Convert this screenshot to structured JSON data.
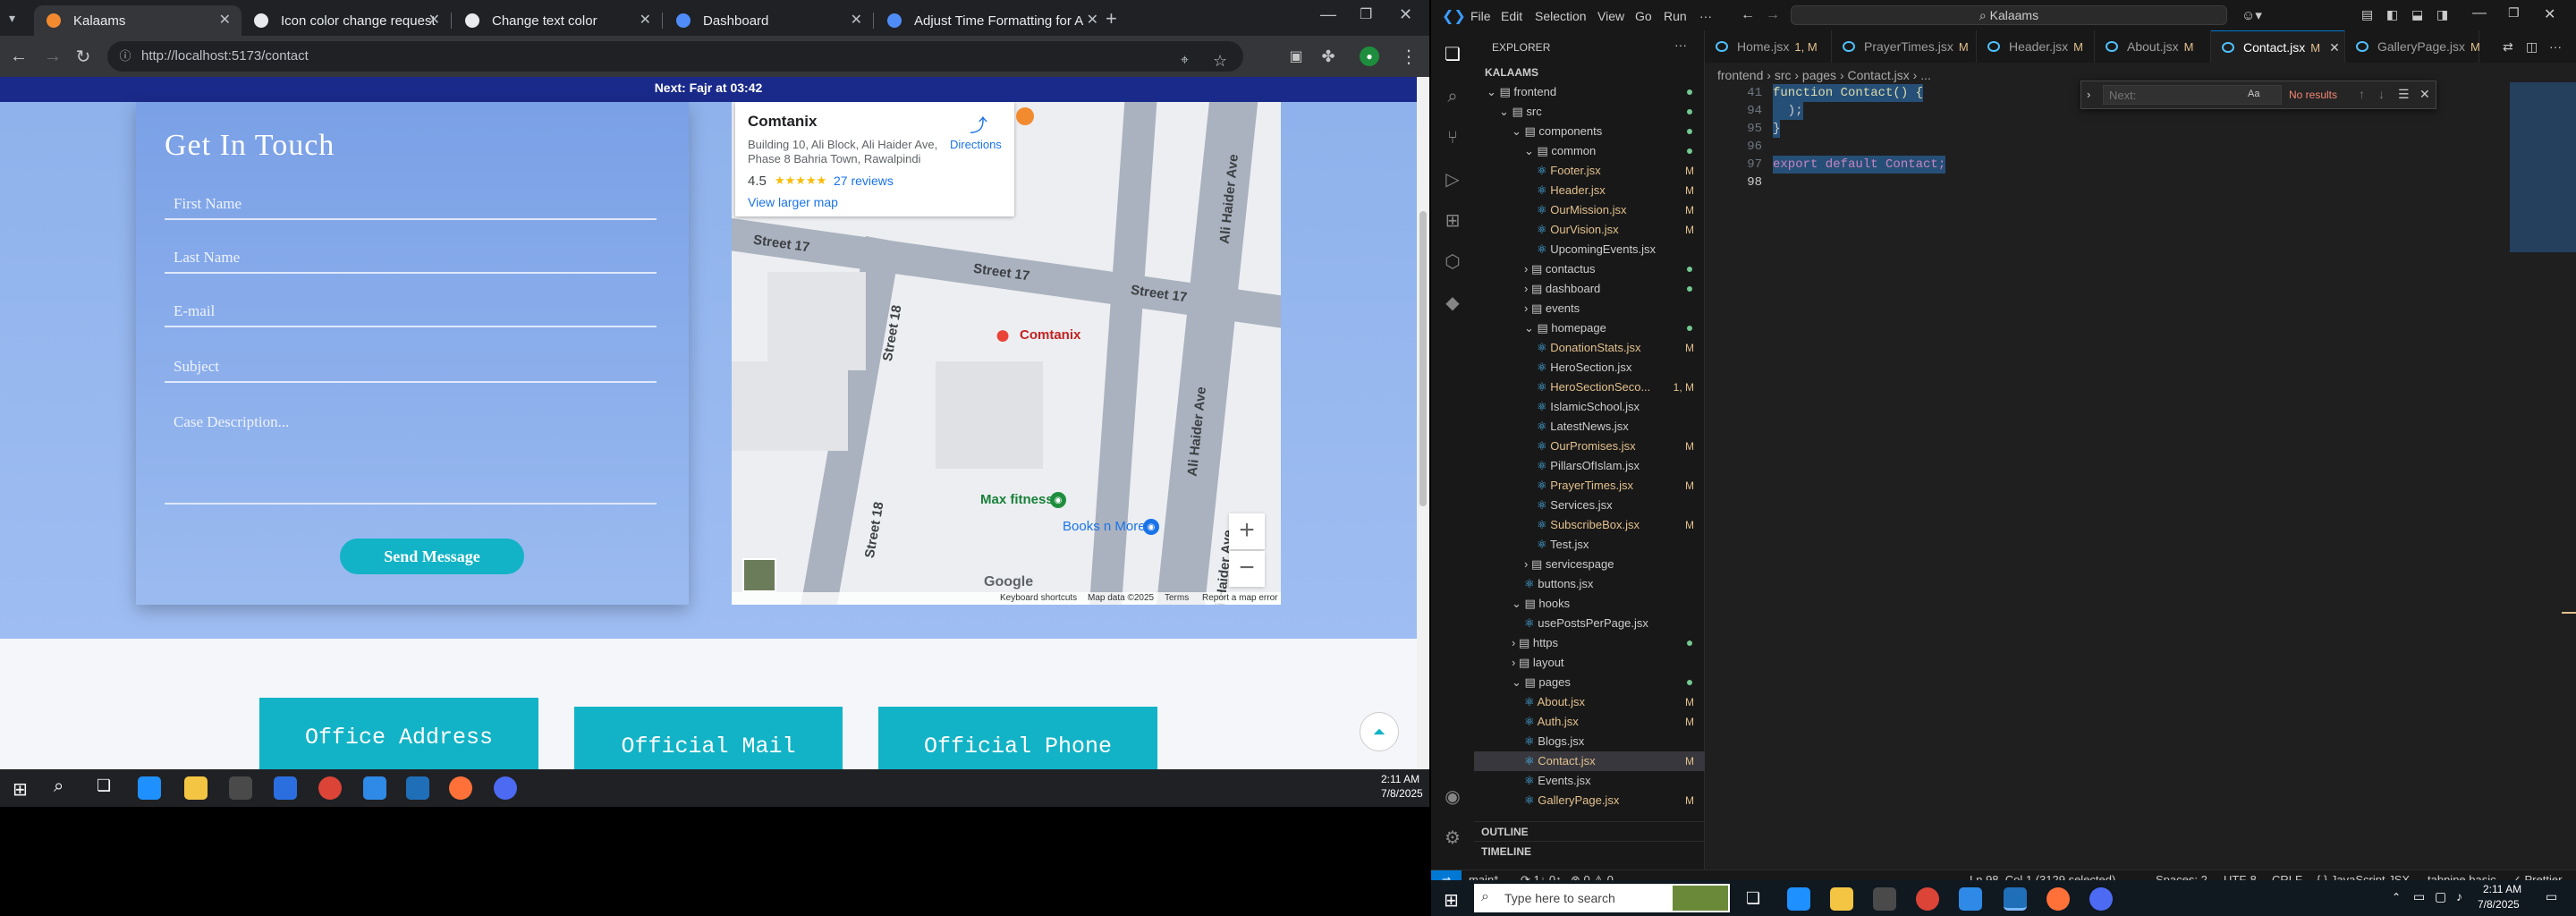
{
  "browser": {
    "tabs": [
      {
        "label": "Kalaams",
        "active": true
      },
      {
        "label": "Icon color change request"
      },
      {
        "label": "Change text color"
      },
      {
        "label": "Dashboard"
      },
      {
        "label": "Adjust Time Formatting for AM"
      }
    ],
    "url": "http://localhost:5173/contact"
  },
  "site": {
    "prayer_bar": "Next: Fajr at 03:42",
    "form": {
      "title": "Get In Touch",
      "first_name": "First Name",
      "last_name": "Last Name",
      "email": "E-mail",
      "subject": "Subject",
      "description": "Case Description...",
      "send": "Send Message"
    },
    "map": {
      "place_name": "Comtanix",
      "address_line1": "Building 10, Ali Block, Ali Haider Ave,",
      "address_line2": "Phase 8 Bahria Town, Rawalpindi",
      "directions": "Directions",
      "rating": "4.5",
      "stars": "★★★★★",
      "reviews": "27 reviews",
      "larger_map": "View larger map",
      "streets": [
        "Street 17",
        "Street 17",
        "Street 17",
        "Street 18",
        "Street 18",
        "Ali Haider Ave",
        "Ali Haider Ave",
        "Ali Haider Ave"
      ],
      "pois": [
        "Comtanix",
        "Max fitness",
        "Books n More"
      ],
      "footer": [
        "Keyboard shortcuts",
        "Map data ©2025",
        "Terms",
        "Report a map error"
      ],
      "google": "Google",
      "zoom_in": "+",
      "zoom_out": "−"
    },
    "info_boxes": [
      "Office Address",
      "Official Mail",
      "Official Phone"
    ]
  },
  "taskbar_left": {
    "time": "2:11 AM",
    "date": "7/8/2025"
  },
  "vscode": {
    "menu": [
      "File",
      "Edit",
      "Selection",
      "View",
      "Go",
      "Run",
      "···"
    ],
    "search": "Kalaams",
    "explorer_title": "EXPLORER",
    "root": "KALAAMS",
    "tree": [
      {
        "label": "frontend",
        "depth": 0,
        "type": "folder-open",
        "dot": true
      },
      {
        "label": "src",
        "depth": 1,
        "type": "folder-open",
        "dot": true
      },
      {
        "label": "components",
        "depth": 2,
        "type": "folder-open",
        "dot": true
      },
      {
        "label": "common",
        "depth": 3,
        "type": "folder-open",
        "dot": true
      },
      {
        "label": "Footer.jsx",
        "depth": 4,
        "type": "file",
        "mod": "M"
      },
      {
        "label": "Header.jsx",
        "depth": 4,
        "type": "file",
        "mod": "M"
      },
      {
        "label": "OurMission.jsx",
        "depth": 4,
        "type": "file",
        "mod": "M"
      },
      {
        "label": "OurVision.jsx",
        "depth": 4,
        "type": "file",
        "mod": "M"
      },
      {
        "label": "UpcomingEvents.jsx",
        "depth": 4,
        "type": "file"
      },
      {
        "label": "contactus",
        "depth": 3,
        "type": "folder",
        "dot": true
      },
      {
        "label": "dashboard",
        "depth": 3,
        "type": "folder",
        "dot": true
      },
      {
        "label": "events",
        "depth": 3,
        "type": "folder"
      },
      {
        "label": "homepage",
        "depth": 3,
        "type": "folder-open",
        "dot": true
      },
      {
        "label": "DonationStats.jsx",
        "depth": 4,
        "type": "file",
        "mod": "M"
      },
      {
        "label": "HeroSection.jsx",
        "depth": 4,
        "type": "file"
      },
      {
        "label": "HeroSectionSeco...",
        "depth": 4,
        "type": "file",
        "mod": "1, M"
      },
      {
        "label": "IslamicSchool.jsx",
        "depth": 4,
        "type": "file"
      },
      {
        "label": "LatestNews.jsx",
        "depth": 4,
        "type": "file"
      },
      {
        "label": "OurPromises.jsx",
        "depth": 4,
        "type": "file",
        "mod": "M"
      },
      {
        "label": "PillarsOfIslam.jsx",
        "depth": 4,
        "type": "file"
      },
      {
        "label": "PrayerTimes.jsx",
        "depth": 4,
        "type": "file",
        "mod": "M"
      },
      {
        "label": "Services.jsx",
        "depth": 4,
        "type": "file"
      },
      {
        "label": "SubscribeBox.jsx",
        "depth": 4,
        "type": "file",
        "mod": "M"
      },
      {
        "label": "Test.jsx",
        "depth": 4,
        "type": "file"
      },
      {
        "label": "servicespage",
        "depth": 3,
        "type": "folder"
      },
      {
        "label": "buttons.jsx",
        "depth": 3,
        "type": "file"
      },
      {
        "label": "hooks",
        "depth": 2,
        "type": "folder-open"
      },
      {
        "label": "usePostsPerPage.jsx",
        "depth": 3,
        "type": "file"
      },
      {
        "label": "https",
        "depth": 2,
        "type": "folder",
        "dot": true
      },
      {
        "label": "layout",
        "depth": 2,
        "type": "folder"
      },
      {
        "label": "pages",
        "depth": 2,
        "type": "folder-open",
        "dot": true
      },
      {
        "label": "About.jsx",
        "depth": 3,
        "type": "file",
        "mod": "M"
      },
      {
        "label": "Auth.jsx",
        "depth": 3,
        "type": "file",
        "mod": "M"
      },
      {
        "label": "Blogs.jsx",
        "depth": 3,
        "type": "file"
      },
      {
        "label": "Contact.jsx",
        "depth": 3,
        "type": "file",
        "mod": "M",
        "selected": true
      },
      {
        "label": "Events.jsx",
        "depth": 3,
        "type": "file"
      },
      {
        "label": "GalleryPage.jsx",
        "depth": 3,
        "type": "file",
        "mod": "M"
      }
    ],
    "outline": "OUTLINE",
    "timeline": "TIMELINE",
    "tabs": [
      {
        "label": "Home.jsx",
        "mod": "1, M"
      },
      {
        "label": "PrayerTimes.jsx",
        "mod": "M"
      },
      {
        "label": "Header.jsx",
        "mod": "M"
      },
      {
        "label": "About.jsx",
        "mod": "M"
      },
      {
        "label": "Contact.jsx",
        "mod": "M",
        "active": true
      },
      {
        "label": "GalleryPage.jsx",
        "mod": "M"
      }
    ],
    "breadcrumbs": "frontend › src › pages › Contact.jsx › ...",
    "code": [
      {
        "ln": "41",
        "text": "function Contact() {"
      },
      {
        "ln": "94",
        "text": "  );"
      },
      {
        "ln": "95",
        "text": "}"
      },
      {
        "ln": "96",
        "text": ""
      },
      {
        "ln": "97",
        "text": "export default Contact;"
      },
      {
        "ln": "98",
        "text": ""
      }
    ],
    "find": {
      "placeholder": "Next:",
      "result": "No results"
    },
    "status": {
      "branch": "main*",
      "sync": "⟳ 1↓ 0↑",
      "problems": "⊗ 0 ⚠ 0",
      "position": "Ln 98, Col 1 (3129 selected)",
      "spaces": "Spaces: 2",
      "encoding": "UTF-8",
      "eol": "CRLF",
      "language": "{ } JavaScript JSX",
      "tabnine": "tabnine basic",
      "prettier": "✓ Prettier"
    }
  },
  "taskbar_right": {
    "search": "Type here to search",
    "time": "2:11 AM",
    "date": "7/8/2025"
  }
}
